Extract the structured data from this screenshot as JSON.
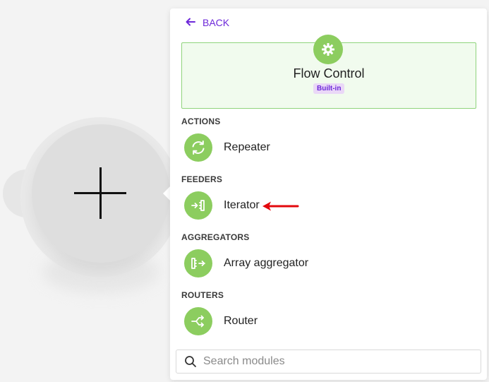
{
  "panel": {
    "back_label": "BACK",
    "app": {
      "title": "Flow Control",
      "badge": "Built-in",
      "icon": "gear-icon"
    },
    "sections": [
      {
        "title": "ACTIONS",
        "modules": [
          {
            "label": "Repeater",
            "icon": "repeat-icon"
          }
        ]
      },
      {
        "title": "FEEDERS",
        "modules": [
          {
            "label": "Iterator",
            "icon": "iterator-icon"
          }
        ]
      },
      {
        "title": "AGGREGATORS",
        "modules": [
          {
            "label": "Array aggregator",
            "icon": "aggregator-icon"
          }
        ]
      },
      {
        "title": "ROUTERS",
        "modules": [
          {
            "label": "Router",
            "icon": "router-icon"
          }
        ]
      }
    ],
    "search": {
      "placeholder": "Search modules",
      "value": ""
    }
  },
  "annotation": {
    "arrow_color": "#e3080d",
    "points_to": "Iterator"
  },
  "colors": {
    "accent": "#6d28d9",
    "module_icon_bg": "#8ccd5f",
    "app_card_bg": "#f1fbee",
    "app_card_border": "#8fd47c"
  }
}
